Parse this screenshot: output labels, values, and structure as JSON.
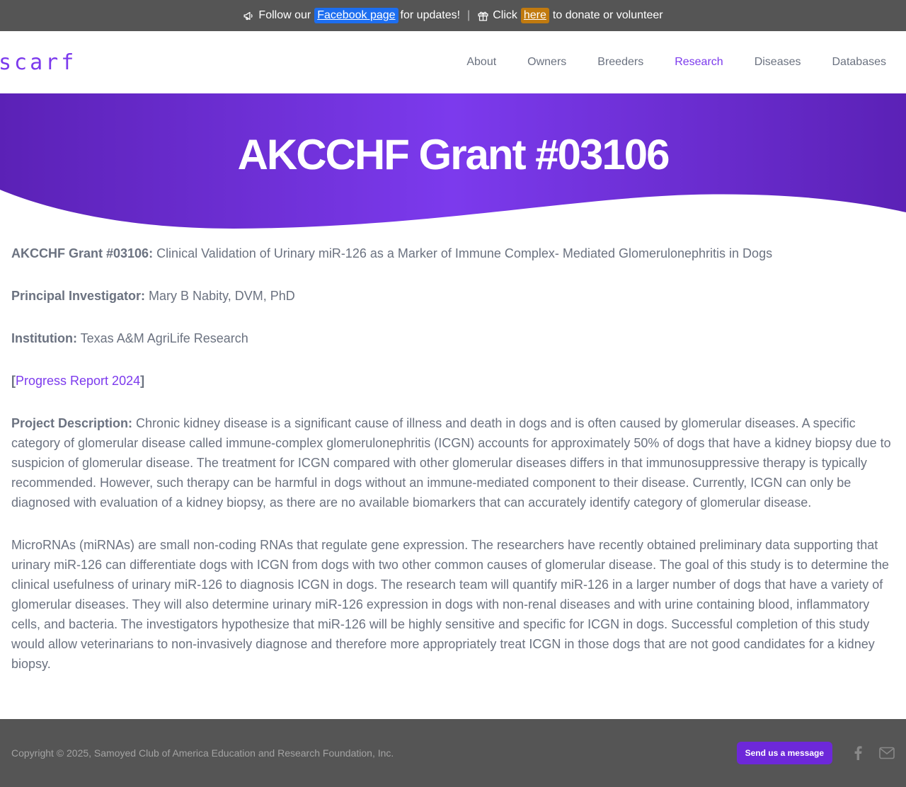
{
  "topbar": {
    "follow_text": "Follow our",
    "facebook_link": "Facebook page",
    "updates_text": "for updates!",
    "separator": "|",
    "click_text": "Click",
    "here_link": "here",
    "donate_text": "to donate or volunteer",
    "icons": [
      "megaphone-icon",
      "gift-icon"
    ]
  },
  "header": {
    "logo": "scarf",
    "nav": [
      {
        "label": "About",
        "active": false
      },
      {
        "label": "Owners",
        "active": false
      },
      {
        "label": "Breeders",
        "active": false
      },
      {
        "label": "Research",
        "active": true
      },
      {
        "label": "Diseases",
        "active": false
      },
      {
        "label": "Databases",
        "active": false
      }
    ]
  },
  "hero": {
    "title": "AKCCHF Grant #03106",
    "gradient": [
      "#5b21b6",
      "#7c3aed",
      "#5b21b6"
    ]
  },
  "content": {
    "grant_label": "AKCCHF Grant #03106:",
    "grant_text": " Clinical Validation of Urinary miR-126 as a Marker of Immune Complex- Mediated Glomerulonephritis in Dogs",
    "pi_label": "Principal Investigator:",
    "pi_text": " Mary B Nabity, DVM, PhD",
    "institution_label": "Institution:",
    "institution_text": " Texas A&M AgriLife Research",
    "report_open": "[",
    "report_link": "Progress Report 2024",
    "report_close": "]",
    "description_label": "Project Description:",
    "description_text": " Chronic kidney disease is a significant cause of illness and death in dogs and is often caused by glomerular diseases. A specific category of glomerular disease called immune-complex glomerulonephritis (ICGN) accounts for approximately 50% of dogs that have a kidney biopsy due to suspicion of glomerular disease. The treatment for ICGN compared with other glomerular diseases differs in that immunosuppressive therapy is typically recommended. However, such therapy can be harmful in dogs without an immune-mediated component to their disease. Currently, ICGN can only be diagnosed with evaluation of a kidney biopsy, as there are no available biomarkers that can accurately identify category of glomerular disease.",
    "mirna_text": "MicroRNAs (miRNAs) are small non-coding RNAs that regulate gene expression. The researchers have recently obtained preliminary data supporting that urinary miR-126 can differentiate dogs with ICGN from dogs with two other common causes of glomerular disease. The goal of this study is to determine the clinical usefulness of urinary miR-126 to diagnosis ICGN in dogs. The research team will quantify miR-126 in a larger number of dogs that have a variety of glomerular diseases. They will also determine urinary miR-126 expression in dogs with non-renal diseases and with urine containing blood, inflammatory cells, and bacteria. The investigators hypothesize that miR-126 will be highly sensitive and specific for ICGN in dogs. Successful completion of this study would allow veterinarians to non-invasively diagnose and therefore more appropriately treat ICGN in those dogs that are not good candidates for a kidney biopsy."
  },
  "footer": {
    "copyright": "Copyright © 2025, Samoyed Club of America Education and Research Foundation, Inc.",
    "message_button": "Send us a message",
    "icons": [
      "facebook-icon",
      "mail-icon"
    ]
  },
  "colors": {
    "accent": "#7c3aed",
    "topbar_bg": "#555555",
    "facebook_bg": "#1d6ef0",
    "donate_bg": "#c17a0f",
    "text": "#6b7280"
  }
}
